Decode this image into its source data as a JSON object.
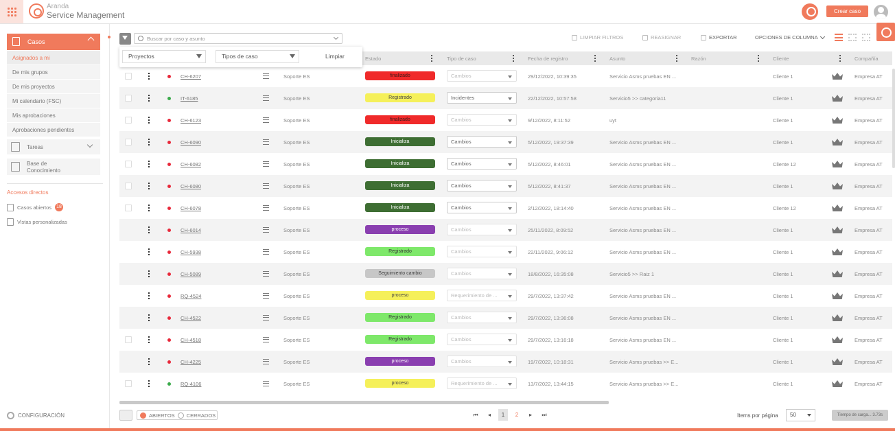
{
  "brand": {
    "line1": "Aranda",
    "line2": "Service Management",
    "accent": "#f07a5c"
  },
  "header": {
    "create_label": "Crear caso"
  },
  "sidebar": {
    "section_label": "Casos",
    "items": [
      {
        "label": "Asignados a mi"
      },
      {
        "label": "De mis grupos"
      },
      {
        "label": "De mis proyectos"
      },
      {
        "label": "Mi calendario (FSC)"
      },
      {
        "label": "Mis aprobaciones"
      },
      {
        "label": "Aprobaciones pendientes"
      }
    ],
    "tasks_label": "Tareas",
    "kb_label": "Base de Conocimiento",
    "shortcuts_title": "Accesos directos",
    "open_cases_label": "Casos abiertos",
    "open_cases_count": "18",
    "custom_views_label": "Vistas personalizadas",
    "config_label": "CONFIGURACIÓN"
  },
  "toolbar": {
    "search_placeholder": "Buscar por caso y asunto",
    "clear_filters": "LIMPIAR FILTROS",
    "reassign": "REASIGNAR",
    "export": "EXPORTAR",
    "column_options": "OPCIONES DE COLUMNA"
  },
  "filter_popup": {
    "projects": "Proyectos",
    "case_types": "Tipos de caso",
    "clear": "Limpiar"
  },
  "columns": [
    "Estado",
    "Tipo de caso",
    "Fecha de registro",
    "Asunto",
    "Razón",
    "Cliente",
    "Compañía"
  ],
  "status_colors": {
    "finalizado": "#f02a2a",
    "Registrado": "#f5f05a",
    "Inicializa": "#3e6e33",
    "proceso": "#8a3fb0",
    "Seguimiento cambio": "#c7c7c7"
  },
  "rows": [
    {
      "id": "CH-6207",
      "service": "Soporte ES",
      "status": "finalizado",
      "status_color": "#f02a2a",
      "status_text": "#3a1a1a",
      "type": "Cambios",
      "type_enabled": false,
      "date": "29/12/2022, 10:39:35",
      "subject": "Servicio Asms pruebas EN ...",
      "client": "Cliente 1",
      "company": "Empresa AT",
      "dot": "#e8283a",
      "checkbox": true
    },
    {
      "id": "IT-6185",
      "service": "Soporte ES",
      "status": "Registrado",
      "status_color": "#f5f05a",
      "status_text": "#444",
      "type": "Incidentes",
      "type_enabled": true,
      "date": "22/12/2022, 10:57:58",
      "subject": "Servicio5 >> categoria11",
      "client": "Cliente 1",
      "company": "Empresa AT",
      "dot": "#3aaa4a",
      "checkbox": true
    },
    {
      "id": "CH-6123",
      "service": "Soporte ES",
      "status": "finalizado",
      "status_color": "#f02a2a",
      "status_text": "#3a1a1a",
      "type": "Cambios",
      "type_enabled": false,
      "date": "9/12/2022, 8:11:52",
      "subject": "uyt",
      "client": "Cliente 1",
      "company": "Empresa AT",
      "dot": "#e8283a",
      "checkbox": true
    },
    {
      "id": "CH-6090",
      "service": "Soporte ES",
      "status": "Inicializa",
      "status_color": "#3e6e33",
      "status_text": "#fff",
      "type": "Cambios",
      "type_enabled": true,
      "date": "5/12/2022, 19:37:39",
      "subject": "Servicio Asms pruebas EN ...",
      "client": "Cliente 1",
      "company": "Empresa AT",
      "dot": "#e8283a",
      "checkbox": true
    },
    {
      "id": "CH-6082",
      "service": "Soporte ES",
      "status": "Inicializa",
      "status_color": "#3e6e33",
      "status_text": "#fff",
      "type": "Cambios",
      "type_enabled": true,
      "date": "5/12/2022, 8:46:01",
      "subject": "Servicio Asms pruebas EN ...",
      "client": "Cliente 12",
      "company": "Empresa AT",
      "dot": "#e8283a",
      "checkbox": true
    },
    {
      "id": "CH-6080",
      "service": "Soporte ES",
      "status": "Inicializa",
      "status_color": "#3e6e33",
      "status_text": "#fff",
      "type": "Cambios",
      "type_enabled": true,
      "date": "5/12/2022, 8:41:37",
      "subject": "Servicio Asms pruebas EN ...",
      "client": "Cliente 1",
      "company": "Empresa AT",
      "dot": "#e8283a",
      "checkbox": true
    },
    {
      "id": "CH-6078",
      "service": "Soporte ES",
      "status": "Inicializa",
      "status_color": "#3e6e33",
      "status_text": "#fff",
      "type": "Cambios",
      "type_enabled": true,
      "date": "2/12/2022, 18:14:40",
      "subject": "Servicio Asms pruebas EN ...",
      "client": "Cliente 12",
      "company": "Empresa AT",
      "dot": "#e8283a",
      "checkbox": true
    },
    {
      "id": "CH-6014",
      "service": "Soporte ES",
      "status": "proceso",
      "status_color": "#8a3fb0",
      "status_text": "#fff",
      "type": "Cambios",
      "type_enabled": false,
      "date": "25/11/2022, 8:09:52",
      "subject": "Servicio Asms pruebas EN ...",
      "client": "Cliente 1",
      "company": "Empresa AT",
      "dot": "#e8283a",
      "checkbox": false
    },
    {
      "id": "CH-5938",
      "service": "Soporte ES",
      "status": "Registrado",
      "status_color": "#7ee86a",
      "status_text": "#333",
      "type": "Cambios",
      "type_enabled": false,
      "date": "22/11/2022, 9:06:12",
      "subject": "Servicio Asms pruebas EN ...",
      "client": "Cliente 1",
      "company": "Empresa AT",
      "dot": "#e8283a",
      "checkbox": false
    },
    {
      "id": "CH-5089",
      "service": "Soporte ES",
      "status": "Seguimiento cambio",
      "status_color": "#c7c7c7",
      "status_text": "#444",
      "type": "Cambios",
      "type_enabled": false,
      "date": "18/8/2022, 16:35:08",
      "subject": "Servicio5 >> Raiz 1",
      "client": "Cliente 1",
      "company": "Empresa AT",
      "dot": "#e8283a",
      "checkbox": false
    },
    {
      "id": "RQ-4524",
      "service": "Soporte ES",
      "status": "proceso",
      "status_color": "#f5f05a",
      "status_text": "#444",
      "type": "Requerimiento de ...",
      "type_enabled": false,
      "date": "29/7/2022, 13:37:42",
      "subject": "Servicio Asms pruebas EN ...",
      "client": "Cliente 1",
      "company": "Empresa AT",
      "dot": "#e8283a",
      "checkbox": false
    },
    {
      "id": "CH-4522",
      "service": "Soporte ES",
      "status": "Registrado",
      "status_color": "#7ee86a",
      "status_text": "#333",
      "type": "Cambios",
      "type_enabled": false,
      "date": "29/7/2022, 13:36:08",
      "subject": "Servicio Asms pruebas EN ...",
      "client": "Cliente 1",
      "company": "Empresa AT",
      "dot": "#e8283a",
      "checkbox": false
    },
    {
      "id": "CH-4518",
      "service": "Soporte ES",
      "status": "Registrado",
      "status_color": "#7ee86a",
      "status_text": "#333",
      "type": "Cambios",
      "type_enabled": false,
      "date": "29/7/2022, 13:16:18",
      "subject": "Servicio Asms pruebas EN ...",
      "client": "Cliente 1",
      "company": "Empresa AT",
      "dot": "#e8283a",
      "checkbox": true
    },
    {
      "id": "CH-4225",
      "service": "Soporte ES",
      "status": "proceso",
      "status_color": "#8a3fb0",
      "status_text": "#fff",
      "type": "Cambios",
      "type_enabled": false,
      "date": "19/7/2022, 10:18:31",
      "subject": "Servicio Asms pruebas >> E...",
      "client": "Cliente 1",
      "company": "Empresa AT",
      "dot": "#e8283a",
      "checkbox": false
    },
    {
      "id": "RQ-4106",
      "service": "Soporte ES",
      "status": "proceso",
      "status_color": "#f5f05a",
      "status_text": "#444",
      "type": "Requerimiento de ...",
      "type_enabled": false,
      "date": "13/7/2022, 13:44:15",
      "subject": "Servicio Asms pruebas >> E...",
      "client": "Cliente 1",
      "company": "Empresa AT",
      "dot": "#3aaa4a",
      "checkbox": true
    }
  ],
  "footer": {
    "open_label": "ABIERTOS",
    "closed_label": "CERRADOS",
    "page_current": "1",
    "page_next": "2",
    "items_per_page_label": "Items por página",
    "items_per_page": "50",
    "load_time": "Tiempo de carga... 3.73s"
  }
}
